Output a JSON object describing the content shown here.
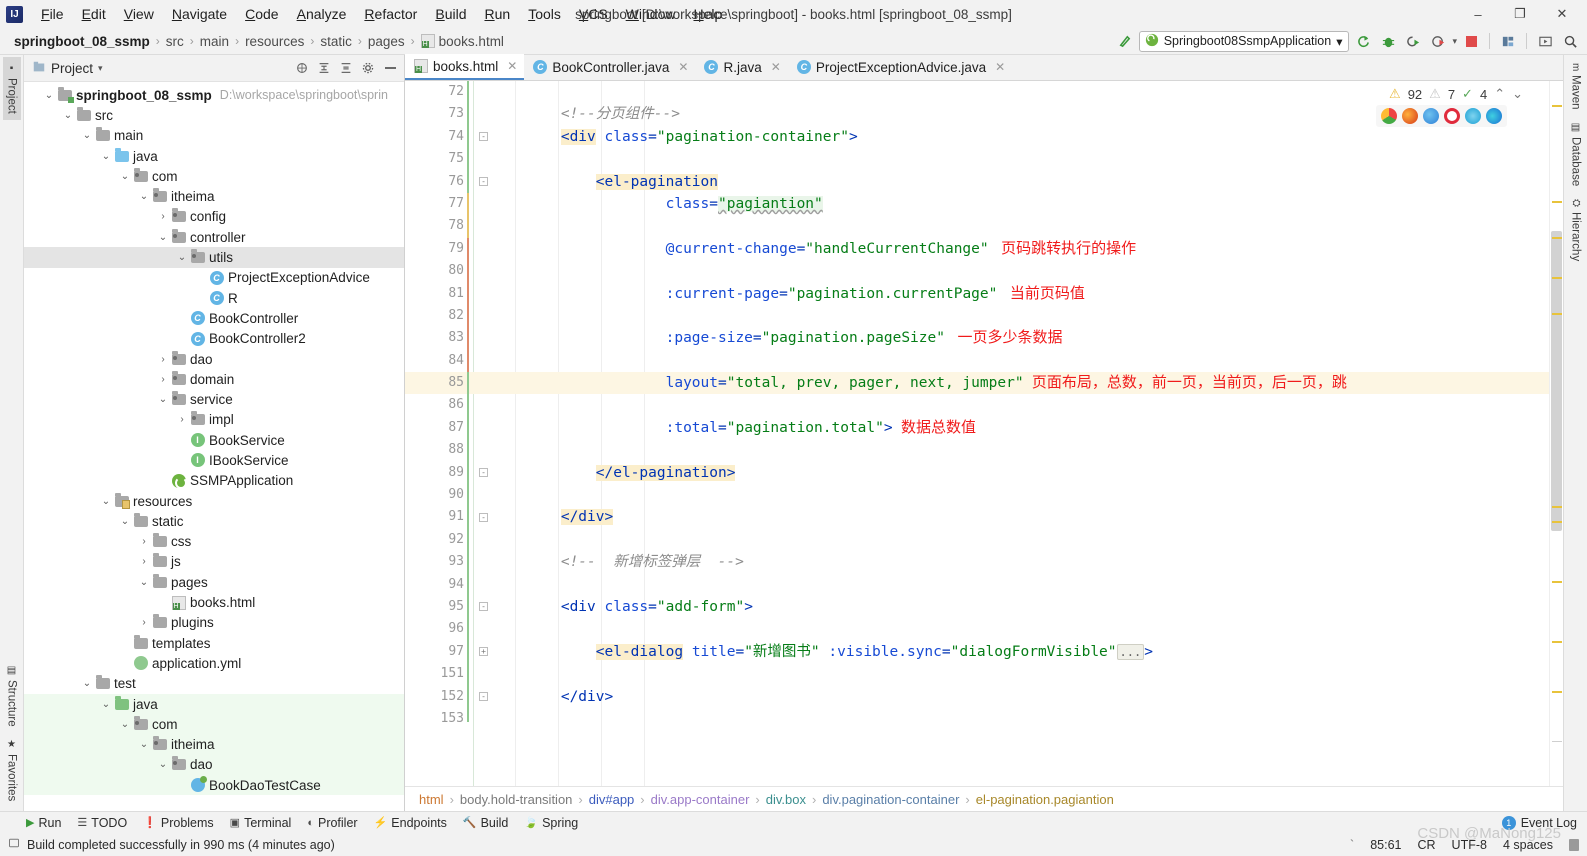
{
  "window": {
    "title": "springboot [D:\\workspace\\springboot] - books.html [springboot_08_ssmp]",
    "minimize": "–",
    "maximize": "❐",
    "close": "✕"
  },
  "menu": {
    "items": [
      "File",
      "Edit",
      "View",
      "Navigate",
      "Code",
      "Analyze",
      "Refactor",
      "Build",
      "Run",
      "Tools",
      "VCS",
      "Window",
      "Help"
    ]
  },
  "navbar": {
    "crumbs": [
      "springboot_08_ssmp",
      "src",
      "main",
      "resources",
      "static",
      "pages",
      "books.html"
    ],
    "run_config": "Springboot08SsmpApplication",
    "dropdown_caret": "▾",
    "buttons": [
      "build-icon",
      "run-icon",
      "debug-icon",
      "run-coverage-icon",
      "profile-icon",
      "stop-icon",
      "project-structure-icon",
      "select-target-icon",
      "search-everywhere-icon"
    ]
  },
  "left_rail": {
    "top": [
      "Project"
    ],
    "bottom": [
      "Structure",
      "Favorites"
    ]
  },
  "right_rail": {
    "items": [
      "Maven",
      "Database",
      "Hierarchy"
    ]
  },
  "project_pane": {
    "title": "Project",
    "caret": "▾",
    "toolbar_icons": [
      "locate-icon",
      "expand-all-icon",
      "collapse-all-icon",
      "settings-icon",
      "hide-icon"
    ],
    "tree": [
      {
        "depth": 0,
        "arrow": "⌄",
        "icon": "module-folder",
        "label": "springboot_08_ssmp",
        "bold": true,
        "path": "D:\\workspace\\springboot\\sprin"
      },
      {
        "depth": 1,
        "arrow": "⌄",
        "icon": "folder-gray",
        "label": "src"
      },
      {
        "depth": 2,
        "arrow": "⌄",
        "icon": "folder-gray",
        "label": "main"
      },
      {
        "depth": 3,
        "arrow": "⌄",
        "icon": "folder-blue",
        "label": "java"
      },
      {
        "depth": 4,
        "arrow": "⌄",
        "icon": "package",
        "label": "com"
      },
      {
        "depth": 5,
        "arrow": "⌄",
        "icon": "package",
        "label": "itheima"
      },
      {
        "depth": 6,
        "arrow": "›",
        "icon": "package",
        "label": "config"
      },
      {
        "depth": 6,
        "arrow": "⌄",
        "icon": "package",
        "label": "controller"
      },
      {
        "depth": 7,
        "arrow": "⌄",
        "icon": "package",
        "label": "utils",
        "selected": true
      },
      {
        "depth": 8,
        "arrow": "",
        "icon": "class",
        "label": "ProjectExceptionAdvice"
      },
      {
        "depth": 8,
        "arrow": "",
        "icon": "class",
        "label": "R"
      },
      {
        "depth": 7,
        "arrow": "",
        "icon": "class",
        "label": "BookController"
      },
      {
        "depth": 7,
        "arrow": "",
        "icon": "class",
        "label": "BookController2"
      },
      {
        "depth": 6,
        "arrow": "›",
        "icon": "package",
        "label": "dao"
      },
      {
        "depth": 6,
        "arrow": "›",
        "icon": "package",
        "label": "domain"
      },
      {
        "depth": 6,
        "arrow": "⌄",
        "icon": "package",
        "label": "service"
      },
      {
        "depth": 7,
        "arrow": "›",
        "icon": "package",
        "label": "impl"
      },
      {
        "depth": 7,
        "arrow": "",
        "icon": "interface",
        "label": "BookService"
      },
      {
        "depth": 7,
        "arrow": "",
        "icon": "interface",
        "label": "IBookService"
      },
      {
        "depth": 6,
        "arrow": "",
        "icon": "spring-boot",
        "label": "SSMPApplication"
      },
      {
        "depth": 3,
        "arrow": "⌄",
        "icon": "resources-folder",
        "label": "resources"
      },
      {
        "depth": 4,
        "arrow": "⌄",
        "icon": "folder-gray",
        "label": "static"
      },
      {
        "depth": 5,
        "arrow": "›",
        "icon": "folder-gray",
        "label": "css"
      },
      {
        "depth": 5,
        "arrow": "›",
        "icon": "folder-gray",
        "label": "js"
      },
      {
        "depth": 5,
        "arrow": "⌄",
        "icon": "folder-gray",
        "label": "pages"
      },
      {
        "depth": 6,
        "arrow": "",
        "icon": "html-file",
        "label": "books.html"
      },
      {
        "depth": 5,
        "arrow": "›",
        "icon": "folder-gray",
        "label": "plugins"
      },
      {
        "depth": 4,
        "arrow": "",
        "icon": "folder-gray",
        "label": "templates"
      },
      {
        "depth": 4,
        "arrow": "",
        "icon": "yaml-file",
        "label": "application.yml"
      },
      {
        "depth": 2,
        "arrow": "⌄",
        "icon": "folder-gray",
        "label": "test"
      },
      {
        "depth": 3,
        "arrow": "⌄",
        "icon": "folder-green",
        "label": "java",
        "test": true
      },
      {
        "depth": 4,
        "arrow": "⌄",
        "icon": "package",
        "label": "com",
        "test": true
      },
      {
        "depth": 5,
        "arrow": "⌄",
        "icon": "package",
        "label": "itheima",
        "test": true
      },
      {
        "depth": 6,
        "arrow": "⌄",
        "icon": "package",
        "label": "dao",
        "test": true
      },
      {
        "depth": 7,
        "arrow": "",
        "icon": "test-class",
        "label": "BookDaoTestCase",
        "test": true
      }
    ]
  },
  "editor": {
    "tabs": [
      {
        "label": "books.html",
        "icon": "html-file",
        "active": true,
        "close": "✕"
      },
      {
        "label": "BookController.java",
        "icon": "class",
        "active": false,
        "close": "✕"
      },
      {
        "label": "R.java",
        "icon": "class",
        "active": false,
        "close": "✕"
      },
      {
        "label": "ProjectExceptionAdvice.java",
        "icon": "class",
        "active": false,
        "close": "✕"
      }
    ],
    "inspection": {
      "warnings": "92",
      "weak_warnings": "7",
      "typos": "4",
      "prev": "⌃",
      "next": "⌄"
    },
    "browsers": [
      "chrome-icon",
      "firefox-icon",
      "safari-icon",
      "opera-icon",
      "ie-icon",
      "edge-icon"
    ],
    "line_numbers": [
      "72",
      "73",
      "74",
      "75",
      "76",
      "77",
      "78",
      "79",
      "80",
      "81",
      "82",
      "83",
      "84",
      "85",
      "86",
      "87",
      "88",
      "89",
      "90",
      "91",
      "92",
      "93",
      "94",
      "95",
      "96",
      "97",
      "151",
      "152",
      "153"
    ],
    "highlighted_line": "85",
    "lines": [
      {
        "num": "72",
        "segments": []
      },
      {
        "num": "73",
        "segments": [
          {
            "t": "        ",
            "c": "plain"
          },
          {
            "t": "<!--分页组件-->",
            "c": "cmt"
          }
        ]
      },
      {
        "num": "74",
        "segments": [
          {
            "t": "        ",
            "c": "plain"
          },
          {
            "t": "<div",
            "c": "tag-hl"
          },
          {
            "t": " ",
            "c": "plain"
          },
          {
            "t": "class",
            "c": "attr"
          },
          {
            "t": "=",
            "c": "pun"
          },
          {
            "t": "\"pagination-container\"",
            "c": "str"
          },
          {
            "t": ">",
            "c": "pun"
          }
        ]
      },
      {
        "num": "75",
        "segments": []
      },
      {
        "num": "76",
        "segments": [
          {
            "t": "            ",
            "c": "plain"
          },
          {
            "t": "<el-pagination",
            "c": "tag-hl"
          }
        ]
      },
      {
        "num": "77",
        "segments": [
          {
            "t": "                    ",
            "c": "plain"
          },
          {
            "t": "class",
            "c": "attr"
          },
          {
            "t": "=",
            "c": "pun"
          },
          {
            "t": "\"pagiantion\"",
            "c": "str-wavy"
          }
        ]
      },
      {
        "num": "78",
        "segments": []
      },
      {
        "num": "79",
        "segments": [
          {
            "t": "                    ",
            "c": "plain"
          },
          {
            "t": "@current-change",
            "c": "attr"
          },
          {
            "t": "=",
            "c": "pun"
          },
          {
            "t": "\"handleCurrentChange\"",
            "c": "str"
          },
          {
            "t": "   页码跳转执行的操作",
            "c": "ann"
          }
        ]
      },
      {
        "num": "80",
        "segments": []
      },
      {
        "num": "81",
        "segments": [
          {
            "t": "                    ",
            "c": "plain"
          },
          {
            "t": ":current-page",
            "c": "attr"
          },
          {
            "t": "=",
            "c": "pun"
          },
          {
            "t": "\"pagination.currentPage\"",
            "c": "str"
          },
          {
            "t": "   当前页码值",
            "c": "ann"
          }
        ]
      },
      {
        "num": "82",
        "segments": []
      },
      {
        "num": "83",
        "segments": [
          {
            "t": "                    ",
            "c": "plain"
          },
          {
            "t": ":page-size",
            "c": "attr"
          },
          {
            "t": "=",
            "c": "pun"
          },
          {
            "t": "\"pagination.pageSize\"",
            "c": "str"
          },
          {
            "t": "   一页多少条数据",
            "c": "ann"
          }
        ]
      },
      {
        "num": "84",
        "segments": []
      },
      {
        "num": "85",
        "highlight": true,
        "segments": [
          {
            "t": "                    ",
            "c": "plain"
          },
          {
            "t": "layout",
            "c": "attr"
          },
          {
            "t": "=",
            "c": "pun"
          },
          {
            "t": "\"total, prev, pager, next, jumper\"",
            "c": "str"
          },
          {
            "t": "  页面布局，总数，前一页，当前页，后一页，跳",
            "c": "ann"
          }
        ]
      },
      {
        "num": "86",
        "segments": []
      },
      {
        "num": "87",
        "segments": [
          {
            "t": "                    ",
            "c": "plain"
          },
          {
            "t": ":total",
            "c": "attr"
          },
          {
            "t": "=",
            "c": "pun"
          },
          {
            "t": "\"pagination.total\"",
            "c": "str"
          },
          {
            "t": ">",
            "c": "pun"
          },
          {
            "t": "  数据总数值",
            "c": "ann"
          }
        ]
      },
      {
        "num": "88",
        "segments": []
      },
      {
        "num": "89",
        "segments": [
          {
            "t": "            ",
            "c": "plain"
          },
          {
            "t": "</el-pagination>",
            "c": "tag-hl"
          }
        ]
      },
      {
        "num": "90",
        "segments": []
      },
      {
        "num": "91",
        "segments": [
          {
            "t": "        ",
            "c": "plain"
          },
          {
            "t": "</div>",
            "c": "tag-hl"
          }
        ]
      },
      {
        "num": "92",
        "segments": []
      },
      {
        "num": "93",
        "segments": [
          {
            "t": "        ",
            "c": "plain"
          },
          {
            "t": "<!--  新增标签弹层  -->",
            "c": "cmt"
          }
        ]
      },
      {
        "num": "94",
        "segments": []
      },
      {
        "num": "95",
        "segments": [
          {
            "t": "        ",
            "c": "plain"
          },
          {
            "t": "<div",
            "c": "tag"
          },
          {
            "t": " ",
            "c": "plain"
          },
          {
            "t": "class",
            "c": "attr"
          },
          {
            "t": "=",
            "c": "pun"
          },
          {
            "t": "\"add-form\"",
            "c": "str"
          },
          {
            "t": ">",
            "c": "pun"
          }
        ]
      },
      {
        "num": "96",
        "segments": []
      },
      {
        "num": "97",
        "segments": [
          {
            "t": "            ",
            "c": "plain"
          },
          {
            "t": "<el-dialog",
            "c": "tag-hl"
          },
          {
            "t": " ",
            "c": "plain"
          },
          {
            "t": "title",
            "c": "attr"
          },
          {
            "t": "=",
            "c": "pun"
          },
          {
            "t": "\"新增图书\"",
            "c": "str"
          },
          {
            "t": " ",
            "c": "plain"
          },
          {
            "t": ":visible.sync",
            "c": "attr"
          },
          {
            "t": "=",
            "c": "pun"
          },
          {
            "t": "\"dialogFormVisible\"",
            "c": "str"
          },
          {
            "t": "...",
            "c": "fold"
          },
          {
            "t": ">",
            "c": "pun"
          }
        ]
      },
      {
        "num": "151",
        "segments": []
      },
      {
        "num": "152",
        "segments": [
          {
            "t": "        ",
            "c": "plain"
          },
          {
            "t": "</div>",
            "c": "tag"
          }
        ]
      },
      {
        "num": "153",
        "segments": []
      }
    ],
    "breadcrumb": [
      "html",
      "body.hold-transition",
      "div#app",
      "div.app-container",
      "div.box",
      "div.pagination-container",
      "el-pagination.pagiantion"
    ]
  },
  "bottom": {
    "tool_windows": [
      {
        "label": "Run",
        "icon": "run-icon"
      },
      {
        "label": "TODO",
        "icon": "todo-icon"
      },
      {
        "label": "Problems",
        "icon": "problems-icon"
      },
      {
        "label": "Terminal",
        "icon": "terminal-icon"
      },
      {
        "label": "Profiler",
        "icon": "profiler-icon"
      },
      {
        "label": "Endpoints",
        "icon": "endpoints-icon"
      },
      {
        "label": "Build",
        "icon": "build-icon"
      },
      {
        "label": "Spring",
        "icon": "spring-icon"
      }
    ],
    "event_log": {
      "label": "Event Log",
      "count": "1"
    }
  },
  "status": {
    "message": "Build completed successfully in 990 ms (4 minutes ago)",
    "position": "85:61",
    "line_separator": "CR",
    "encoding": "UTF-8",
    "indent": "4 spaces",
    "tick": "`"
  },
  "watermark": "CSDN @MaNong125",
  "colors": {
    "accent": "#4a86c8",
    "annotation_red": "#f01b1b",
    "string_green": "#067d17",
    "tag_blue": "#0033b3",
    "warning_yellow": "#e8b93b"
  }
}
